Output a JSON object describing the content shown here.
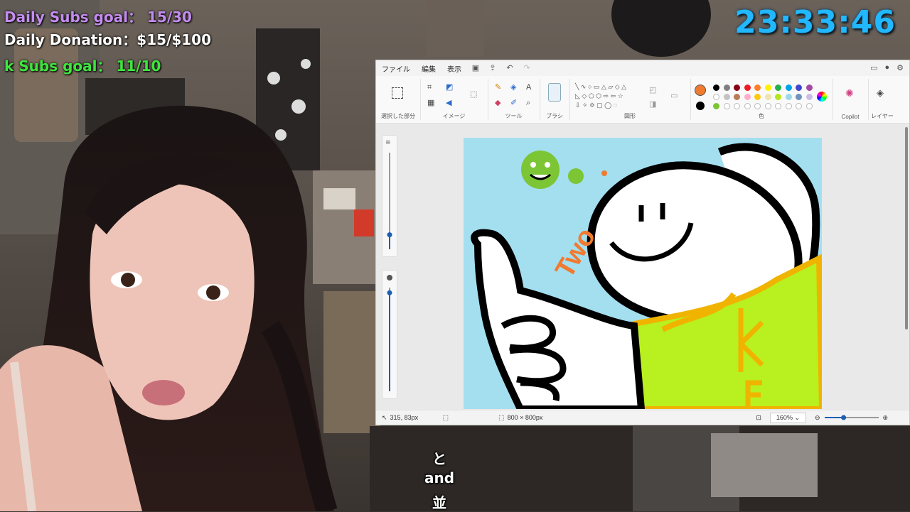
{
  "overlay": {
    "subs_goal": "Daily Subs goal： 15/30",
    "donation": "Daily Donation：$15/$100",
    "k_subs": "k Subs goal： 11/10",
    "clock": "23:33:46",
    "colors": {
      "subs": "#c58cf0",
      "donation": "#ffffff",
      "k_subs": "#3ee63e",
      "clock": "#22b8ff"
    }
  },
  "captions": [
    "と",
    "and",
    "並"
  ],
  "paint": {
    "menu": [
      "ファイル",
      "編集",
      "表示"
    ],
    "toolbar_icons": [
      "save-icon",
      "share-icon",
      "undo-icon",
      "redo-icon"
    ],
    "window_controls": [
      "comment-icon",
      "profile-icon",
      "settings-icon"
    ],
    "groups": {
      "selection": "選択した部分",
      "image": "イメージ",
      "tools": "ツール",
      "brush": "ブラシ",
      "shapes": "図形",
      "color": "色",
      "copilot": "Copilot",
      "layers": "レイヤー"
    },
    "palette_row1": [
      "#000000",
      "#7f7f7f",
      "#880015",
      "#ed1c24",
      "#ff7f27",
      "#fff200",
      "#22b14c",
      "#00a2e8",
      "#3f48cc",
      "#a349a4"
    ],
    "palette_row2": [
      "#ffffff",
      "#c3c3c3",
      "#b97a57",
      "#ffaec9",
      "#ffc90e",
      "#efe4b0",
      "#b5e61d",
      "#99d9ea",
      "#7092be",
      "#c8bfe7"
    ],
    "palette_row3": [
      "#7cc534",
      "#ffffff",
      "#ffffff",
      "#ffffff",
      "#ffffff",
      "#ffffff",
      "#ffffff",
      "#ffffff",
      "#ffffff",
      "#ffffff"
    ],
    "primary_color": "#f07a30",
    "secondary_color": "#000000",
    "status": {
      "cursor_pos": "315, 83px",
      "canvas_size": "800 × 800px",
      "zoom": "160%"
    },
    "size_slider_level": 0.15,
    "opacity_slider_level": 0.95,
    "zoom_slider_level": 0.35
  },
  "drawing_text": [
    "Two",
    "KE"
  ]
}
